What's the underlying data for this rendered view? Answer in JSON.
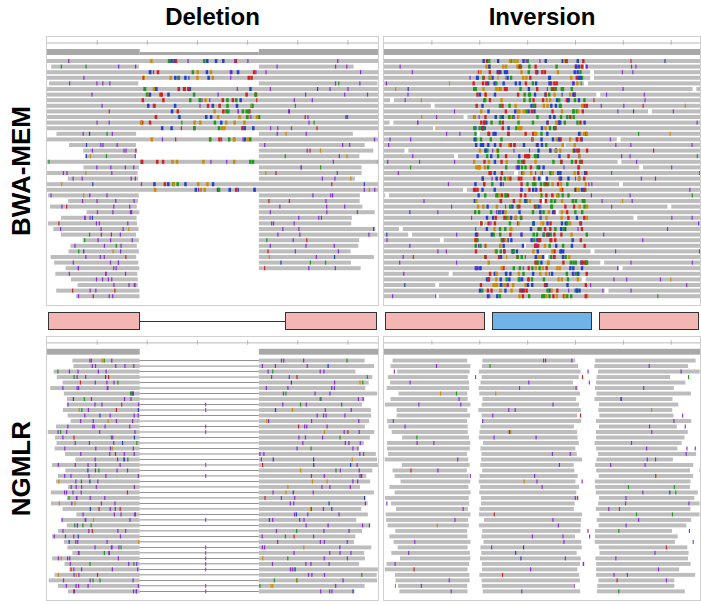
{
  "figure": {
    "columns": [
      "Deletion",
      "Inversion"
    ],
    "rows": [
      {
        "label": "BWA-MEM",
        "panels": [
          {
            "event": "deletion",
            "pattern": "clipped"
          },
          {
            "event": "inversion",
            "pattern": "mismatch"
          }
        ]
      },
      {
        "label": "NGMLR",
        "panels": [
          {
            "event": "deletion",
            "pattern": "spanning"
          },
          {
            "event": "inversion",
            "pattern": "split"
          }
        ]
      }
    ],
    "schematics": [
      {
        "event": "deletion",
        "segments": [
          {
            "kind": "block",
            "color": "#f4b6b2"
          },
          {
            "kind": "line",
            "color": "#333333"
          },
          {
            "kind": "block",
            "color": "#f4b6b2"
          }
        ]
      },
      {
        "event": "inversion",
        "segments": [
          {
            "kind": "block",
            "color": "#f4b6b2"
          },
          {
            "kind": "block",
            "color": "#6fb3e8"
          },
          {
            "kind": "block",
            "color": "#f4b6b2"
          }
        ]
      }
    ]
  }
}
